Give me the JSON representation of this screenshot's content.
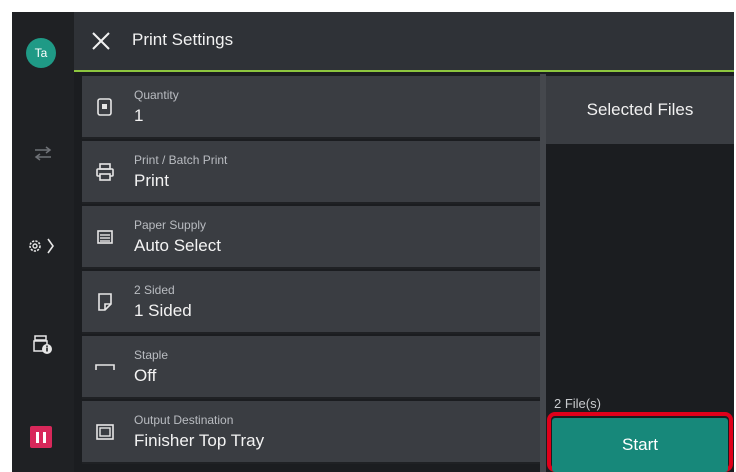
{
  "user": {
    "initials": "Ta"
  },
  "header": {
    "title": "Print Settings"
  },
  "rail": {
    "icons": [
      "job-transfer-icon",
      "settings-gear-icon",
      "printer-info-icon",
      "pause-icon"
    ]
  },
  "settings": [
    {
      "label": "Quantity",
      "value": "1",
      "icon": "quantity-icon"
    },
    {
      "label": "Print / Batch Print",
      "value": "Print",
      "icon": "printer-icon"
    },
    {
      "label": "Paper Supply",
      "value": "Auto Select",
      "icon": "paper-tray-icon"
    },
    {
      "label": "2 Sided",
      "value": "1 Sided",
      "icon": "duplex-icon"
    },
    {
      "label": "Staple",
      "value": "Off",
      "icon": "staple-icon"
    },
    {
      "label": "Output Destination",
      "value": "Finisher Top Tray",
      "icon": "output-tray-icon"
    }
  ],
  "files": {
    "header": "Selected Files",
    "count": "2 File(s)"
  },
  "start_label": "Start",
  "colors": {
    "accent_green": "#8dc63f",
    "start_teal": "#17887a",
    "highlight_red": "#e0001a",
    "pause_pink": "#d8285a"
  }
}
